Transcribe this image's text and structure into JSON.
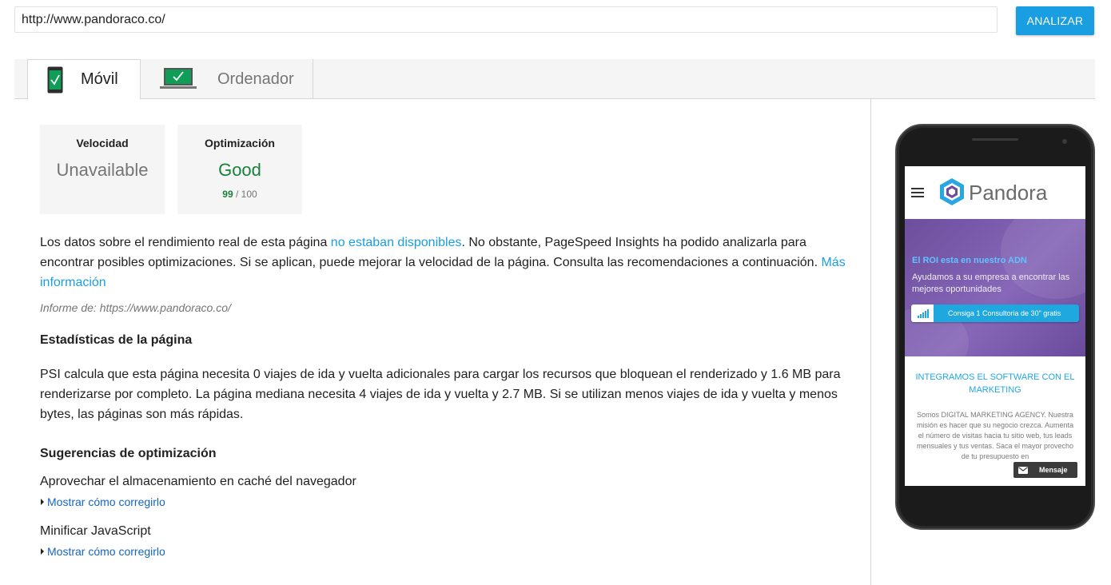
{
  "search": {
    "url_value": "http://www.pandoraco.co/",
    "analyze_label": "ANALIZAR"
  },
  "tabs": [
    {
      "label": "Móvil",
      "icon": "phone-check-icon",
      "active": true
    },
    {
      "label": "Ordenador",
      "icon": "laptop-check-icon",
      "active": false
    }
  ],
  "scores": {
    "speed": {
      "title": "Velocidad",
      "value": "Unavailable"
    },
    "optimization": {
      "title": "Optimización",
      "value": "Good",
      "score": "99",
      "out_of": "/ 100"
    }
  },
  "summary": {
    "text_1": "Los datos sobre el rendimiento real de esta página ",
    "link_1": "no estaban disponibles",
    "text_2": ". No obstante, PageSpeed Insights ha podido analizarla para encontrar posibles optimizaciones. Si se aplican, puede mejorar la velocidad de la página. Consulta las recomendaciones a continuación. ",
    "link_2": "Más información",
    "report": "Informe de: https://www.pandoraco.co/"
  },
  "stats": {
    "heading": "Estadísticas de la página",
    "text": "PSI calcula que esta página necesita 0 viajes de ida y vuelta adicionales para cargar los recursos que bloquean el renderizado y 1.6 MB para renderizarse por completo. La página mediana necesita 4 viajes de ida y vuelta y 2.7 MB. Si se utilizan menos viajes de ida y vuelta y menos bytes, las páginas son más rápidas."
  },
  "suggestions": {
    "heading": "Sugerencias de optimización",
    "items": [
      {
        "title": "Aprovechar el almacenamiento en caché del navegador",
        "action": "Mostrar cómo corregirlo"
      },
      {
        "title": "Minificar JavaScript",
        "action": "Mostrar cómo corregirlo"
      }
    ]
  },
  "preview": {
    "brand": "Pandora",
    "hero_title": "El ROI esta en nuestro ADN",
    "hero_sub": "Ayudamos a su empresa a encontrar las mejores oportunidades",
    "hero_button": "Consiga 1 Consultoria de 30\" gratis",
    "section_title": "INTEGRAMOS EL SOFTWARE CON EL MARKETING",
    "section_text": "Somos DIGITAL MARKETING AGENCY. Nuestra misión es hacer que su negocio crezca. Aumenta el número de visitas hacia tu sitio web, tus leads mensuales y tus ventas. Saca el mayor provecho de tu presupuesto en",
    "message_button": "Mensaje"
  },
  "colors": {
    "accent": "#1a9ee2",
    "good": "#178239",
    "muted": "#757575",
    "hero": "#7a5aae"
  }
}
